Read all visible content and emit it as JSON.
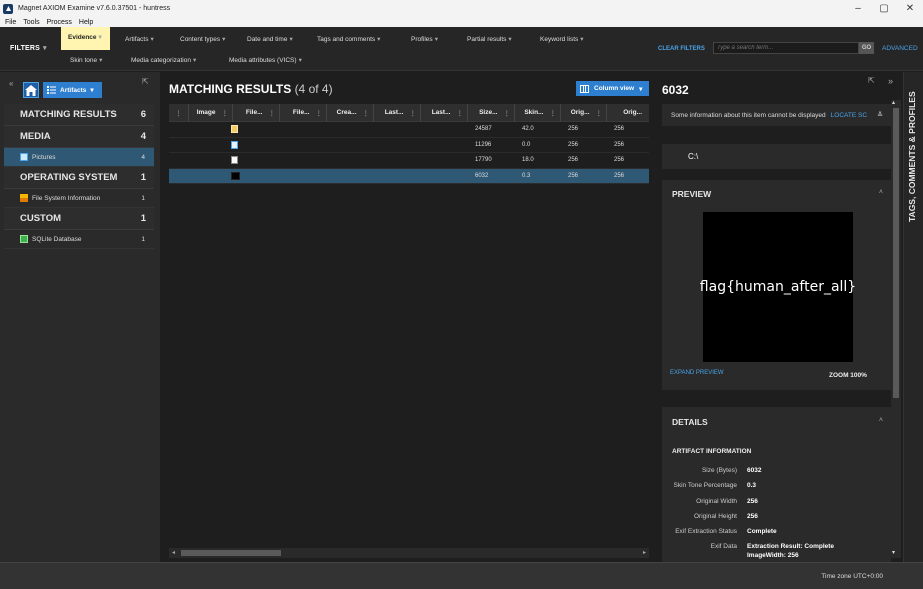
{
  "window": {
    "title": "Magnet AXIOM Examine v7.6.0.37501 - huntress",
    "controls": [
      "–",
      "▢",
      "✕"
    ]
  },
  "menu": [
    "File",
    "Tools",
    "Process",
    "Help"
  ],
  "filters": {
    "label": "FILTERS",
    "row1": [
      "Evidence",
      "Artifacts",
      "Content types",
      "Date and time",
      "Tags and comments",
      "Profiles",
      "Partial results",
      "Keyword lists"
    ],
    "row2": [
      "Skin tone",
      "Media categorization",
      "Media attributes (VICS)"
    ],
    "clear": "CLEAR FILTERS",
    "search_placeholder": "Type a search term...",
    "go": "GO",
    "advanced": "ADVANCED"
  },
  "left": {
    "selector": "Artifacts",
    "categories": [
      {
        "name": "MATCHING RESULTS",
        "count": "6"
      },
      {
        "name": "MEDIA",
        "count": "4"
      },
      {
        "name": "OPERATING SYSTEM",
        "count": "1"
      },
      {
        "name": "CUSTOM",
        "count": "1"
      }
    ],
    "items": [
      {
        "name": "Pictures",
        "count": "4"
      },
      {
        "name": "File System Information",
        "count": "1"
      },
      {
        "name": "SQLite Database",
        "count": "1"
      }
    ]
  },
  "results": {
    "title": "MATCHING RESULTS",
    "count": "(4 of 4)",
    "view": "Column view",
    "columns": [
      "Image",
      "File...",
      "File...",
      "Crea...",
      "Last...",
      "Last...",
      "Size...",
      "Skin...",
      "Orig...",
      "Orig..."
    ],
    "rows": [
      {
        "size": "24587",
        "skin": "42.0",
        "w": "256",
        "h": "256"
      },
      {
        "size": "11296",
        "skin": "0.0",
        "w": "256",
        "h": "256"
      },
      {
        "size": "17790",
        "skin": "18.0",
        "w": "256",
        "h": "256"
      },
      {
        "size": "6032",
        "skin": "0.3",
        "w": "256",
        "h": "256"
      }
    ]
  },
  "detail": {
    "title": "6032",
    "info": "Some information about this item cannot be displayed",
    "locate": "LOCATE SC",
    "path": "C:\\",
    "preview_label": "PREVIEW",
    "preview_text": "flag{human_after_all}",
    "expand_preview": "EXPAND PREVIEW",
    "zoom": "ZOOM 100%",
    "details_label": "DETAILS",
    "artifact_info": "ARTIFACT INFORMATION",
    "fields": [
      {
        "k": "Size (Bytes)",
        "v": "6032"
      },
      {
        "k": "Skin Tone Percentage",
        "v": "0.3"
      },
      {
        "k": "Original Width",
        "v": "256"
      },
      {
        "k": "Original Height",
        "v": "256"
      },
      {
        "k": "Exif Extraction Status",
        "v": "Complete"
      },
      {
        "k": "Exif Data",
        "v": "Extraction Result: Complete"
      },
      {
        "k": "",
        "v": "ImageWidth: 256"
      }
    ]
  },
  "side_tab": "TAGS, COMMENTS & PROFILES",
  "status": {
    "timezone": "Time zone   UTC+0:00"
  }
}
